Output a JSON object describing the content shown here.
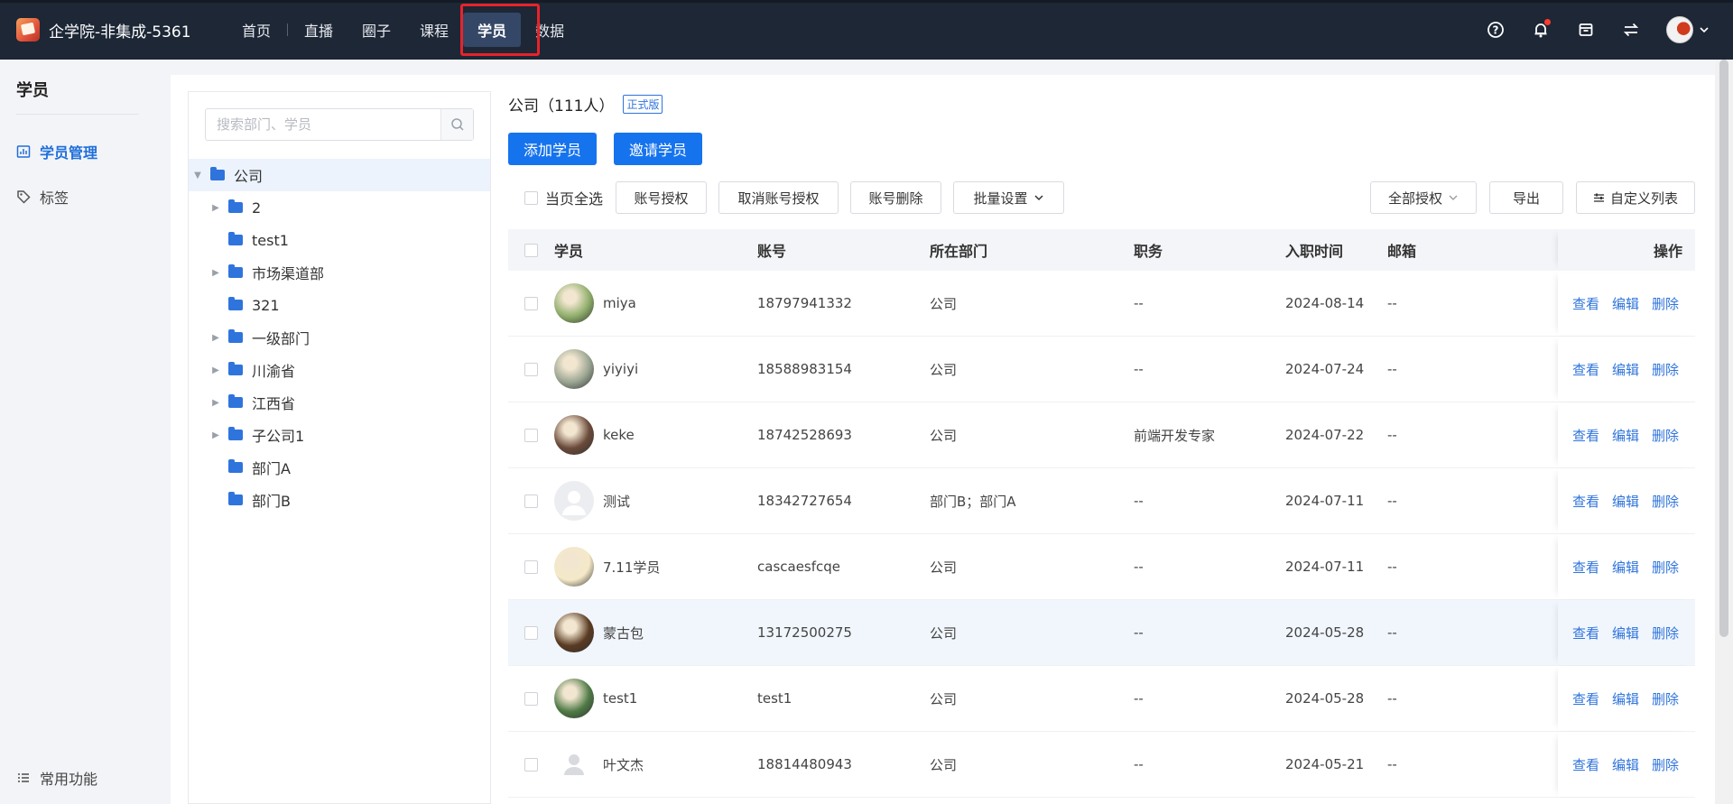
{
  "app": {
    "brand_name": "企学院-非集成-5361"
  },
  "nav": {
    "items": [
      {
        "label": "首页",
        "active": false
      },
      {
        "label": "直播",
        "active": false
      },
      {
        "label": "圈子",
        "active": false
      },
      {
        "label": "课程",
        "active": false
      },
      {
        "label": "学员",
        "active": true
      },
      {
        "label": "数据",
        "active": false
      }
    ]
  },
  "colors": {
    "topbar": "#1d2736",
    "accent": "#1673ee",
    "link": "#2f74dc",
    "highlight": "#e8232a"
  },
  "sidebar": {
    "title": "学员",
    "items": [
      {
        "label": "学员管理",
        "icon": "chart-icon",
        "active": true
      },
      {
        "label": "标签",
        "icon": "tag-icon",
        "active": false
      }
    ],
    "bottom": {
      "label": "常用功能",
      "icon": "list-icon"
    }
  },
  "tree": {
    "search_placeholder": "搜索部门、学员",
    "root": "公司",
    "children": [
      {
        "label": "2",
        "expandable": true
      },
      {
        "label": "test1",
        "expandable": false
      },
      {
        "label": "市场渠道部",
        "expandable": true
      },
      {
        "label": "321",
        "expandable": false
      },
      {
        "label": "一级部门",
        "expandable": true
      },
      {
        "label": "川渝省",
        "expandable": true
      },
      {
        "label": "江西省",
        "expandable": true
      },
      {
        "label": "子公司1",
        "expandable": true
      },
      {
        "label": "部门A",
        "expandable": false
      },
      {
        "label": "部门B",
        "expandable": false
      }
    ]
  },
  "content": {
    "title": "公司（111人）",
    "badge": "正式版",
    "add_button": "添加学员",
    "invite_button": "邀请学员",
    "toolbar": {
      "select_all": "当页全选",
      "authorize": "账号授权",
      "cancel_authorize": "取消账号授权",
      "delete": "账号删除",
      "batch_settings": "批量设置",
      "all_authorization": "全部授权",
      "export": "导出",
      "custom_columns": "自定义列表"
    },
    "columns": {
      "student": "学员",
      "account": "账号",
      "department": "所在部门",
      "position": "职务",
      "join_date": "入职时间",
      "email": "邮箱",
      "actions": "操作"
    },
    "actions": {
      "view": "查看",
      "edit": "编辑",
      "delete": "删除"
    },
    "rows": [
      {
        "name": "miya",
        "account": "18797941332",
        "department": "公司",
        "position": "--",
        "join_date": "2024-08-14",
        "email": "--",
        "avatar_color": "#8fae6b"
      },
      {
        "name": "yiyiyi",
        "account": "18588983154",
        "department": "公司",
        "position": "--",
        "join_date": "2024-07-24",
        "email": "--",
        "avatar_color": "#9aa592"
      },
      {
        "name": "keke",
        "account": "18742528693",
        "department": "公司",
        "position": "前端开发专家",
        "join_date": "2024-07-22",
        "email": "--",
        "avatar_color": "#6b4a3a"
      },
      {
        "name": "测试",
        "account": "18342727654",
        "department": "部门B；部门A",
        "position": "--",
        "join_date": "2024-07-11",
        "email": "--",
        "avatar_color": "#e6e7ea"
      },
      {
        "name": "7.11学员",
        "account": "cascaesfcqe",
        "department": "公司",
        "position": "--",
        "join_date": "2024-07-11",
        "email": "--",
        "avatar_color": "#f5e9c8"
      },
      {
        "name": "蒙古包",
        "account": "13172500275",
        "department": "公司",
        "position": "--",
        "join_date": "2024-05-28",
        "email": "--",
        "avatar_color": "#5a3b22"
      },
      {
        "name": "test1",
        "account": "test1",
        "department": "公司",
        "position": "--",
        "join_date": "2024-05-28",
        "email": "--",
        "avatar_color": "#4f7a46"
      },
      {
        "name": "叶文杰",
        "account": "18814480943",
        "department": "公司",
        "position": "--",
        "join_date": "2024-05-21",
        "email": "--",
        "avatar_color": "#ffffff"
      }
    ]
  }
}
